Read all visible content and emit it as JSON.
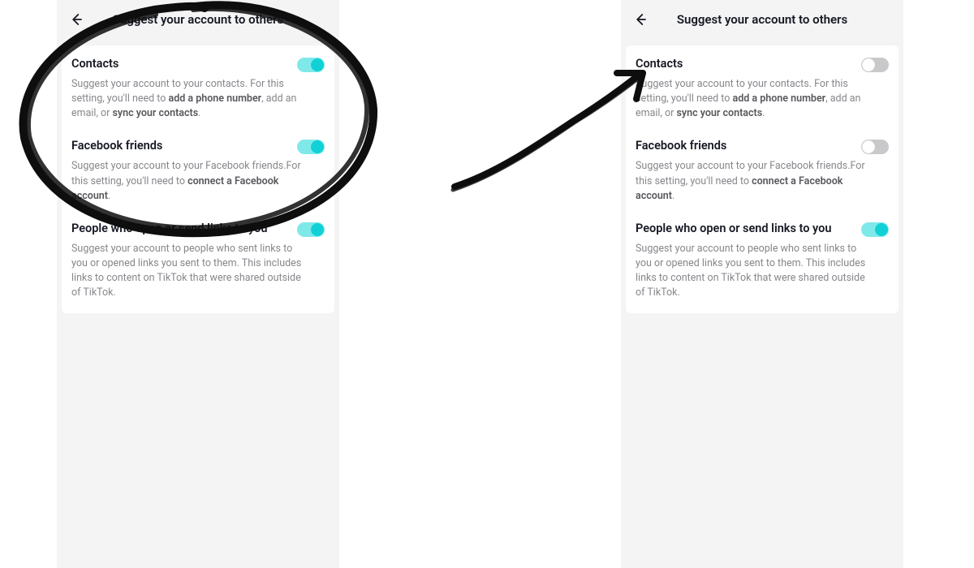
{
  "title": "Suggest your account to others",
  "settings": {
    "contacts": {
      "title": "Contacts",
      "desc_pre": "Suggest your account to your contacts. For this setting, you'll need to ",
      "link1": "add a phone number",
      "desc_mid": ", add an email, or ",
      "link2": "sync your contacts",
      "desc_post": "."
    },
    "facebook": {
      "title": "Facebook friends",
      "desc_pre": "Suggest your account to your Facebook friends.For this setting, you'll need to ",
      "link1": "connect a Facebook account",
      "desc_post": "."
    },
    "links": {
      "title": "People who open or send links to you",
      "desc": "Suggest your account to people who sent links to you or opened links you sent to them. This includes links to content on TikTok that were shared outside of TikTok."
    }
  },
  "left_state": {
    "contacts": "on",
    "facebook": "on",
    "links": "on"
  },
  "right_state": {
    "contacts": "off",
    "facebook": "off",
    "links": "on"
  }
}
